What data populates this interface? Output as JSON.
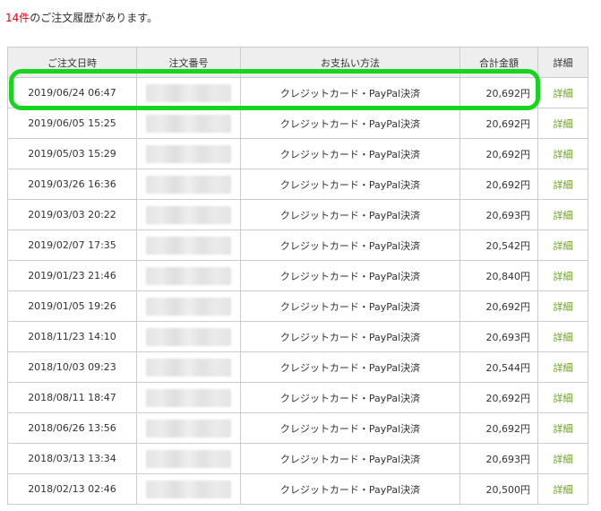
{
  "summary": {
    "count": "14件",
    "text": "のご注文履歴があります。"
  },
  "colors": {
    "count_red": "#e60012",
    "detail_green": "#6aa31d",
    "highlight_green": "#17d41e",
    "header_bg": "#eeeeee"
  },
  "table": {
    "headers": {
      "date": "ご注文日時",
      "number": "注文番号",
      "payment": "お支払い方法",
      "total": "合計金額",
      "detail": "詳細"
    },
    "rows": [
      {
        "date": "2019/06/24 06:47",
        "payment": "クレジットカード・PayPal決済",
        "total": "20,692円",
        "detail": "詳細"
      },
      {
        "date": "2019/06/05 15:25",
        "payment": "クレジットカード・PayPal決済",
        "total": "20,692円",
        "detail": "詳細"
      },
      {
        "date": "2019/05/03 15:29",
        "payment": "クレジットカード・PayPal決済",
        "total": "20,692円",
        "detail": "詳細"
      },
      {
        "date": "2019/03/26 16:36",
        "payment": "クレジットカード・PayPal決済",
        "total": "20,692円",
        "detail": "詳細"
      },
      {
        "date": "2019/03/03 20:22",
        "payment": "クレジットカード・PayPal決済",
        "total": "20,693円",
        "detail": "詳細"
      },
      {
        "date": "2019/02/07 17:35",
        "payment": "クレジットカード・PayPal決済",
        "total": "20,542円",
        "detail": "詳細"
      },
      {
        "date": "2019/01/23 21:46",
        "payment": "クレジットカード・PayPal決済",
        "total": "20,840円",
        "detail": "詳細"
      },
      {
        "date": "2019/01/05 19:26",
        "payment": "クレジットカード・PayPal決済",
        "total": "20,692円",
        "detail": "詳細"
      },
      {
        "date": "2018/11/23 14:10",
        "payment": "クレジットカード・PayPal決済",
        "total": "20,693円",
        "detail": "詳細"
      },
      {
        "date": "2018/10/03 09:23",
        "payment": "クレジットカード・PayPal決済",
        "total": "20,544円",
        "detail": "詳細"
      },
      {
        "date": "2018/08/11 18:47",
        "payment": "クレジットカード・PayPal決済",
        "total": "20,692円",
        "detail": "詳細"
      },
      {
        "date": "2018/06/26 13:56",
        "payment": "クレジットカード・PayPal決済",
        "total": "20,692円",
        "detail": "詳細"
      },
      {
        "date": "2018/03/13 13:34",
        "payment": "クレジットカード・PayPal決済",
        "total": "20,693円",
        "detail": "詳細"
      },
      {
        "date": "2018/02/13 02:46",
        "payment": "クレジットカード・PayPal決済",
        "total": "20,500円",
        "detail": "詳細"
      }
    ]
  }
}
